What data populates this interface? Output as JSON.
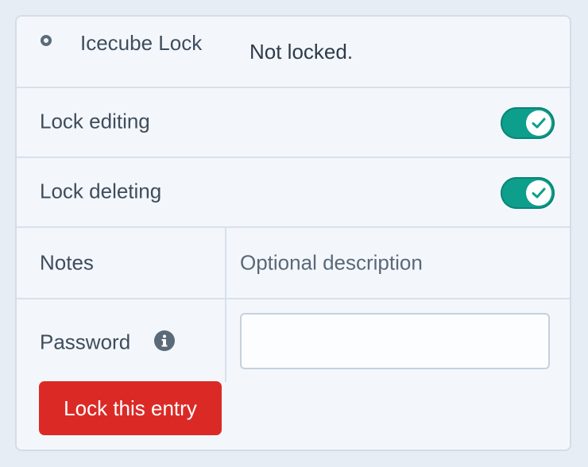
{
  "header": {
    "title": "Icecube Lock",
    "status": "Not locked."
  },
  "settings": {
    "lock_editing": {
      "label": "Lock editing",
      "enabled": true
    },
    "lock_deleting": {
      "label": "Lock deleting",
      "enabled": true
    }
  },
  "notes": {
    "label": "Notes",
    "value": "Optional description"
  },
  "password": {
    "label": "Password",
    "value": "",
    "info_icon": "info-icon"
  },
  "actions": {
    "lock_button": "Lock this entry"
  },
  "colors": {
    "toggle_on": "#0e9e8c",
    "danger_button": "#db2a26",
    "panel_bg": "#f3f7fc",
    "page_bg": "#e6edf5"
  }
}
